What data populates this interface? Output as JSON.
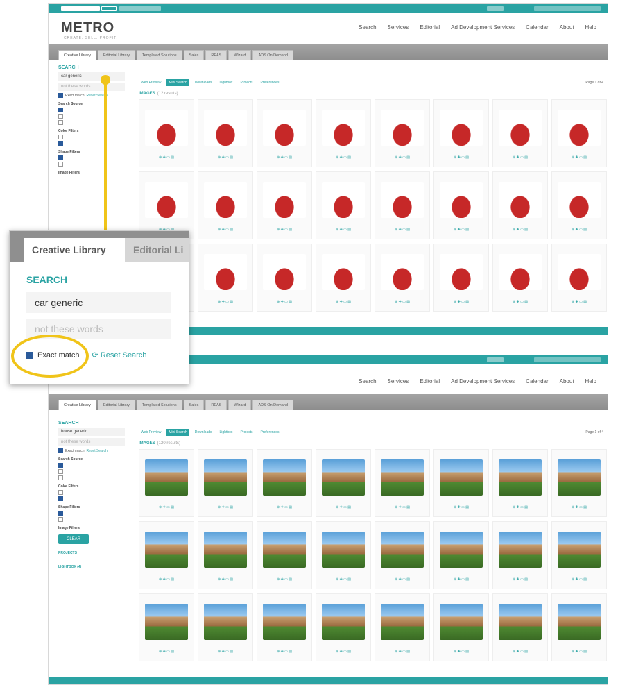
{
  "top": {
    "logo": "METRO",
    "logo_sub": "CREATE. SELL. PROFIT.",
    "nav": [
      "Search",
      "Services",
      "Editorial",
      "Ad Development Services",
      "Calendar",
      "About",
      "Help"
    ],
    "tabs": [
      "Creative Library",
      "Editorial Library",
      "Templated Solutions",
      "Sales",
      "REAS",
      "Wizard",
      "ADS On Demand"
    ],
    "sidebar": {
      "search_title": "SEARCH",
      "query": "car generic",
      "not_words": "not these words",
      "exact_match": "Exact match",
      "reset": "Reset Search",
      "sections": [
        "Search Source",
        "Color Filters",
        "Shape Filters",
        "Image Filters"
      ]
    },
    "toolbar": [
      "Web Preview",
      "Mini Search",
      "Downloads",
      "Lightbox",
      "Projects",
      "Preferences"
    ],
    "images_label": "IMAGES",
    "images_count": "(12 results)",
    "pager": "Page 1 of 4"
  },
  "zoom": {
    "tab1": "Creative Library",
    "tab2": "Editorial Li",
    "search_title": "SEARCH",
    "query": "car generic",
    "not_words": "not these words",
    "exact_match": "Exact match",
    "reset": "Reset Search"
  },
  "bottom": {
    "nav": [
      "Search",
      "Services",
      "Editorial",
      "Ad Development Services",
      "Calendar",
      "About",
      "Help"
    ],
    "tabs": [
      "Creative Library",
      "Editorial Library",
      "Templated Solutions",
      "Sales",
      "REAS",
      "Wizard",
      "ADS On Demand"
    ],
    "sidebar": {
      "search_title": "SEARCH",
      "query": "house generic",
      "not_words": "not these words",
      "exact_match": "Exact match",
      "reset": "Reset Search",
      "sections": [
        "Search Source",
        "Color Filters",
        "Shape Filters",
        "Image Filters"
      ],
      "clear": "CLEAR",
      "projects": "PROJECTS",
      "lightbox": "LIGHTBOX (4)"
    },
    "toolbar": [
      "Web Preview",
      "Mini Search",
      "Downloads",
      "Lightbox",
      "Projects",
      "Preferences"
    ],
    "images_label": "IMAGES",
    "images_count": "(120 results)",
    "pager": "Page 1 of 4"
  }
}
